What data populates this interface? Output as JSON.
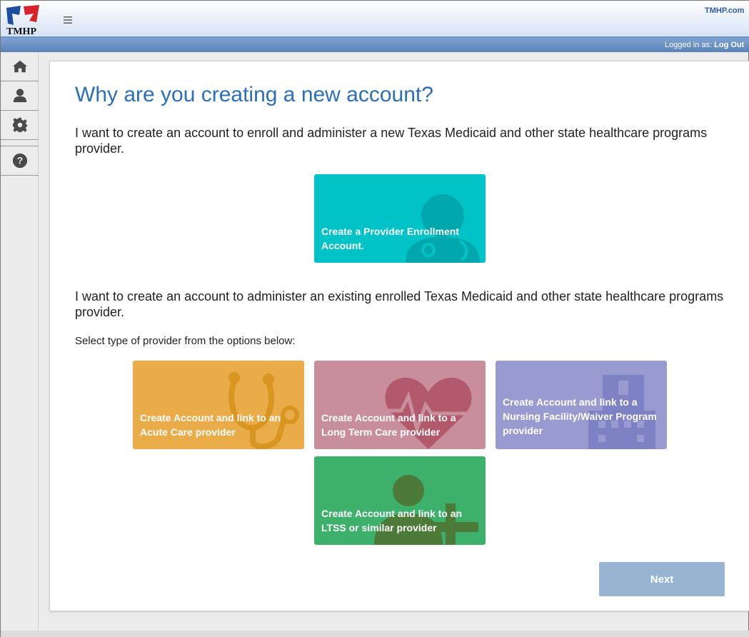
{
  "header": {
    "logo_text": "TMHP",
    "menu_icon": "hamburger-icon",
    "site_link": "TMHP.com",
    "logged_in_label": "Logged in as:",
    "logout_label": "Log Out"
  },
  "sidebar": {
    "items": [
      {
        "icon": "home-icon"
      },
      {
        "icon": "user-icon"
      },
      {
        "icon": "gear-icon"
      },
      {
        "icon": "help-icon"
      }
    ]
  },
  "main": {
    "title": "Why are you creating a new account?",
    "new_provider_text": "I want to create an account to enroll and administer a new Texas Medicaid and other state healthcare programs provider.",
    "enroll_tile": {
      "label": "Create a Provider Enrollment Account.",
      "color": "#00c3c8",
      "icon": "doctor-icon"
    },
    "existing_provider_text": "I want to create an account to administer an existing enrolled Texas Medicaid and other state healthcare programs provider.",
    "select_label": "Select type of provider from the options below:",
    "provider_tiles": [
      {
        "label": "Create Account and link to an Acute Care provider",
        "color": "#eaab49",
        "icon": "stethoscope-icon"
      },
      {
        "label": "Create Account and link to a Long Term Care provider",
        "color": "#c98e9b",
        "icon": "heart-pulse-icon"
      },
      {
        "label": "Create Account and link to a Nursing Facility/Waiver Program provider",
        "color": "#989ad0",
        "icon": "building-icon"
      },
      {
        "label": "Create Account and link to an LTSS or similar provider",
        "color": "#3db06c",
        "icon": "person-cross-icon"
      }
    ],
    "next_label": "Next"
  }
}
